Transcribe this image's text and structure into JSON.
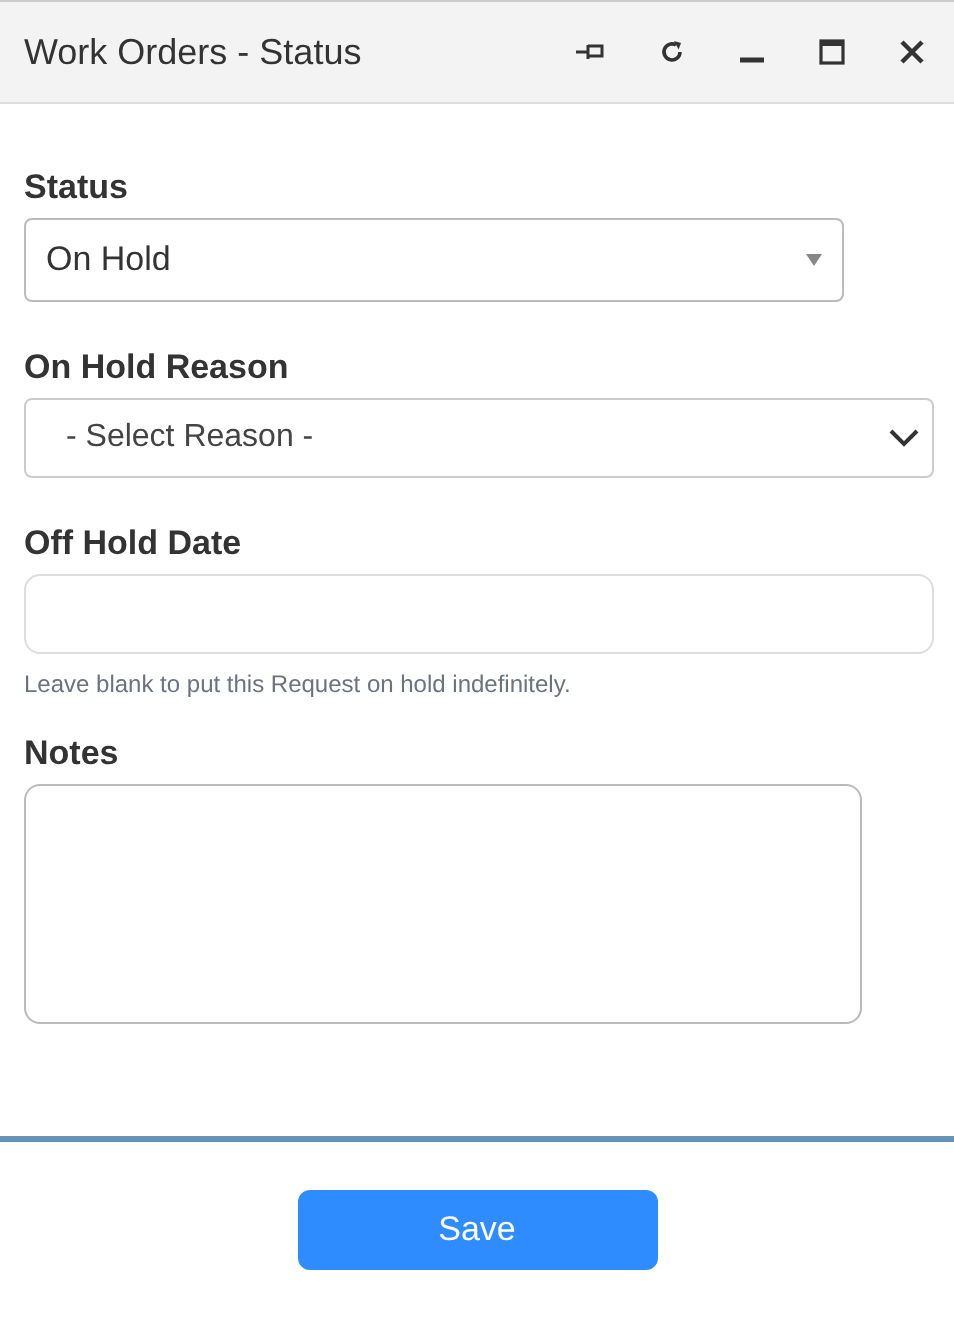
{
  "window": {
    "title": "Work Orders - Status"
  },
  "fields": [
    {
      "kind": "dropdown",
      "label": "Status",
      "value": "On Hold"
    },
    {
      "kind": "select",
      "label": "On Hold Reason",
      "placeholder": "- Select Reason -"
    },
    {
      "kind": "text",
      "label": "Off Hold Date",
      "help": "Leave blank to put this Request on hold indefinitely."
    },
    {
      "kind": "textarea",
      "label": "Notes"
    }
  ],
  "buttons": [
    "Save"
  ]
}
